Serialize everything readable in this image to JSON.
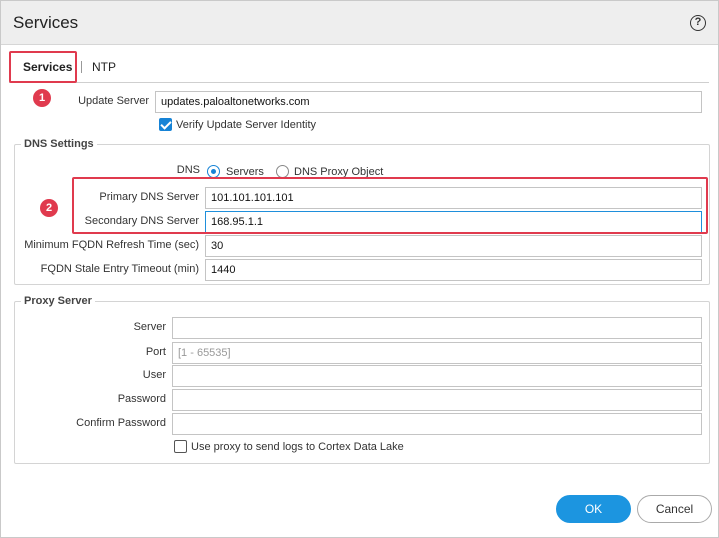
{
  "dialog": {
    "title": "Services",
    "help_glyph": "?"
  },
  "tabs": [
    {
      "label": "Services",
      "active": true
    },
    {
      "label": "NTP",
      "active": false
    }
  ],
  "callouts": {
    "first": "1",
    "second": "2"
  },
  "update": {
    "server_label": "Update Server",
    "server_value": "updates.paloaltonetworks.com",
    "verify_label": "Verify Update Server Identity",
    "verify_checked": true
  },
  "dns": {
    "group_title": "DNS Settings",
    "mode_label": "DNS",
    "mode_options": [
      "Servers",
      "DNS Proxy Object"
    ],
    "mode_selected": "Servers",
    "primary_label": "Primary DNS Server",
    "primary_value": "101.101.101.101",
    "secondary_label": "Secondary DNS Server",
    "secondary_value": "168.95.1.1",
    "refresh_label": "Minimum FQDN Refresh Time (sec)",
    "refresh_value": "30",
    "stale_label": "FQDN Stale Entry Timeout (min)",
    "stale_value": "1440"
  },
  "proxy": {
    "group_title": "Proxy Server",
    "server_label": "Server",
    "server_value": "",
    "port_label": "Port",
    "port_placeholder": "[1 - 65535]",
    "user_label": "User",
    "user_value": "",
    "password_label": "Password",
    "password_value": "",
    "confirm_label": "Confirm Password",
    "confirm_value": "",
    "logs_label": "Use proxy to send logs to Cortex Data Lake",
    "logs_checked": false
  },
  "buttons": {
    "ok": "OK",
    "cancel": "Cancel"
  },
  "colors": {
    "accent": "#1c95e0",
    "callout": "#e03a4e",
    "titlebar": "#eeeeee"
  }
}
